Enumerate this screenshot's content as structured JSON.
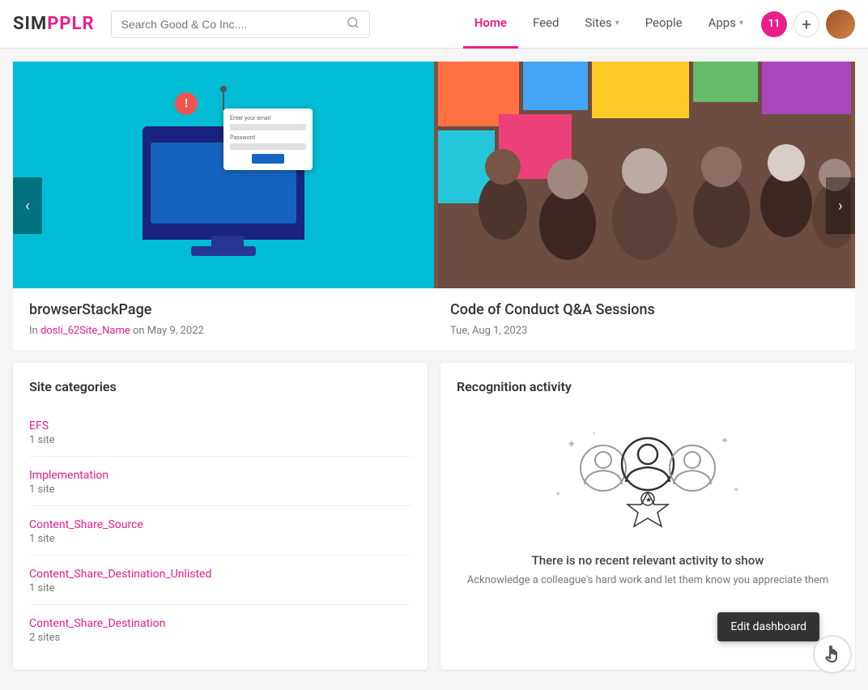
{
  "header": {
    "logo_text_sim": "SIM",
    "logo_text_pplr": "PPLR",
    "search_placeholder": "Search Good & Co Inc....",
    "nav_items": [
      {
        "label": "Home",
        "active": true,
        "has_chevron": false
      },
      {
        "label": "Feed",
        "active": false,
        "has_chevron": false
      },
      {
        "label": "Sites",
        "active": false,
        "has_chevron": true
      },
      {
        "label": "People",
        "active": false,
        "has_chevron": false
      },
      {
        "label": "Apps",
        "active": false,
        "has_chevron": true
      }
    ],
    "notif_count": "11",
    "add_icon": "+",
    "logo_brand": "SIMPPLR"
  },
  "carousel": {
    "prev_label": "‹",
    "next_label": "›",
    "cards": [
      {
        "id": "card-1",
        "title": "browserStackPage",
        "meta_prefix": "In",
        "meta_link": "dosli_62Site_Name",
        "meta_suffix": "on May 9, 2022"
      },
      {
        "id": "card-2",
        "title": "Code of Conduct Q&A Sessions",
        "meta_date": "Tue, Aug 1, 2023"
      }
    ]
  },
  "site_categories": {
    "title": "Site categories",
    "items": [
      {
        "name": "EFS",
        "count": "1 site"
      },
      {
        "name": "Implementation",
        "count": "1 site"
      },
      {
        "name": "Content_Share_Source",
        "count": "1 site"
      },
      {
        "name": "Content_Share_Destination_Unlisted",
        "count": "1 site"
      },
      {
        "name": "Content_Share_Destination",
        "count": "2 sites"
      }
    ]
  },
  "recognition": {
    "title": "Recognition activity",
    "empty_title": "There is no recent relevant activity to show",
    "empty_sub": "Acknowledge a colleague's hard work and let them know you appreciate them"
  },
  "edit_dashboard": {
    "label": "Edit dashboard"
  },
  "icons": {
    "search": "🔍",
    "cursor": "🖱"
  }
}
